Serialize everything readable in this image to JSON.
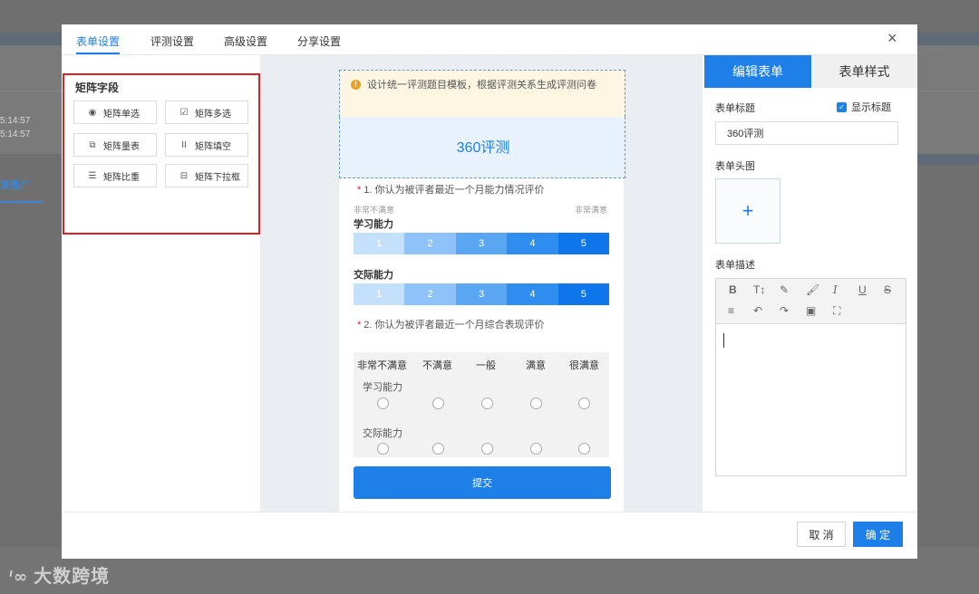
{
  "background": {
    "times": [
      "5:14:57",
      "5:14:57"
    ],
    "tab_label": "享推广",
    "watermark": "大数跨境"
  },
  "dialog": {
    "tabs": [
      {
        "label": "表单设置",
        "active": true
      },
      {
        "label": "评测设置",
        "active": false
      },
      {
        "label": "高级设置",
        "active": false
      },
      {
        "label": "分享设置",
        "active": false
      }
    ],
    "close_icon": "×"
  },
  "left_panel": {
    "section_title": "矩阵字段",
    "fields": [
      {
        "label": "矩阵单选",
        "icon": "radio-icon"
      },
      {
        "label": "矩阵多选",
        "icon": "checkbox-icon"
      },
      {
        "label": "矩阵量表",
        "icon": "copy-icon"
      },
      {
        "label": "矩阵填空",
        "icon": "text-cursor-icon"
      },
      {
        "label": "矩阵比重",
        "icon": "list-box-icon"
      },
      {
        "label": "矩阵下拉框",
        "icon": "dropdown-icon"
      }
    ]
  },
  "form_preview": {
    "notice": "设计统一评测题目模板，根据评测关系生成评测问卷",
    "title": "360评测",
    "q1": {
      "title": "1. 你认为被评者最近一个月能力情况评价",
      "scale_low": "非常不满意",
      "scale_high": "非常满意",
      "rows": [
        "学习能力",
        "交际能力"
      ],
      "scale": [
        "1",
        "2",
        "3",
        "4",
        "5"
      ],
      "colors": [
        "#c5e0fb",
        "#8ec2f8",
        "#5aa6f3",
        "#2f8df0",
        "#0f75eb"
      ]
    },
    "q2": {
      "title": "2. 你认为被评者最近一个月综合表现评价",
      "columns": [
        "非常不满意",
        "不满意",
        "一般",
        "满意",
        "很满意"
      ],
      "rows": [
        "学习能力",
        "交际能力"
      ]
    },
    "submit_label": "提交"
  },
  "right_panel": {
    "tab_edit": "编辑表单",
    "tab_style": "表单样式",
    "form_title_label": "表单标题",
    "show_title_label": "显示标题",
    "show_title_checked": true,
    "form_title_value": "360评测",
    "header_image_label": "表单头图",
    "upload_icon": "+",
    "description_label": "表单描述",
    "toolbar": [
      "bold-icon",
      "text-size-icon",
      "highlight-icon",
      "brush-icon",
      "italic-icon",
      "underline-icon",
      "strikethrough-icon",
      "align-icon",
      "undo-icon",
      "redo-icon",
      "image-icon",
      "fullscreen-icon"
    ]
  },
  "footer": {
    "cancel_label": "取 消",
    "ok_label": "确 定"
  }
}
